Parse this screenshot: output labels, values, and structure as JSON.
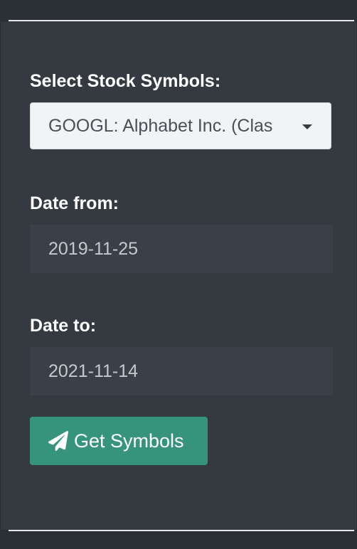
{
  "form": {
    "symbols_label": "Select Stock Symbols:",
    "symbols_selected": "GOOGL: Alphabet Inc. (Clas",
    "date_from_label": "Date from:",
    "date_from_value": "2019-11-25",
    "date_to_label": "Date to:",
    "date_to_value": "2021-11-14",
    "submit_label": "Get Symbols",
    "submit_icon": "paper-plane-icon"
  },
  "colors": {
    "panel_bg": "#343a40",
    "input_bg": "#3a4047",
    "button_bg": "#36937c",
    "select_bg": "#f2f3f4",
    "label_text": "#ffffff"
  }
}
